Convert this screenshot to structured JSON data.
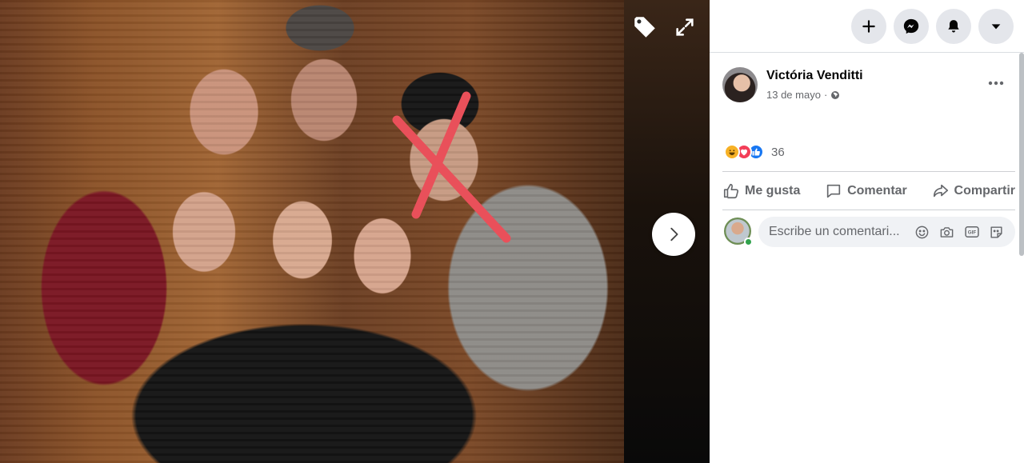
{
  "viewer": {
    "tag_icon": "tag-icon",
    "expand_icon": "expand-icon",
    "next_icon": "chevron-right-icon"
  },
  "topbar": {
    "buttons": [
      "plus-icon",
      "messenger-icon",
      "bell-icon",
      "caret-down-icon"
    ]
  },
  "post": {
    "author": "Victória Venditti",
    "date": "13 de mayo",
    "date_separator": "·",
    "privacy_icon": "globe-icon"
  },
  "reactions": {
    "types": [
      "haha",
      "love",
      "like"
    ],
    "count": "36"
  },
  "actions": {
    "like": "Me gusta",
    "comment": "Comentar",
    "share": "Compartir"
  },
  "comment": {
    "placeholder": "Escribe un comentari...",
    "icons": [
      "emoji-icon",
      "camera-icon",
      "gif-icon",
      "sticker-icon"
    ]
  },
  "colors": {
    "secondary_text": "#65676b",
    "button_bg": "#e4e6eb",
    "like_blue": "#1877f2",
    "love_red": "#f33e58",
    "haha_yellow": "#f7b125",
    "online_green": "#31a24c"
  }
}
